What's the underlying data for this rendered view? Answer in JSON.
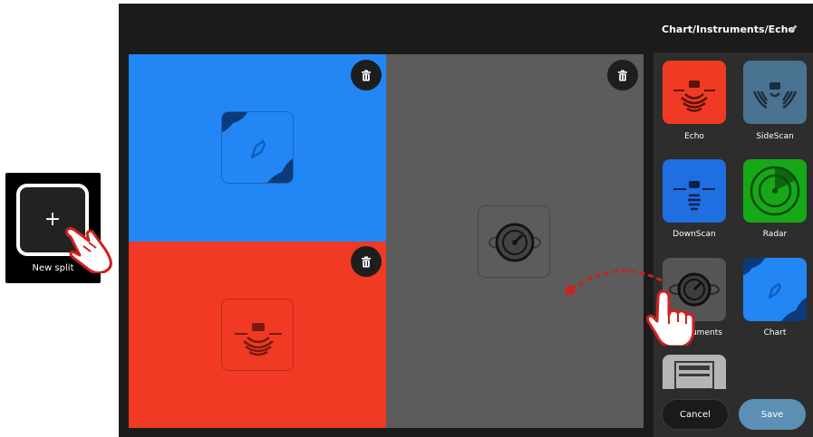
{
  "new_split": {
    "label": "New split",
    "plus": "+"
  },
  "sidebar": {
    "title": "Chart/Instruments/Echo",
    "tiles": [
      {
        "label": "Echo",
        "icon": "echo-icon",
        "color": "#f03a23"
      },
      {
        "label": "SideScan",
        "icon": "sidescan-icon",
        "color": "#4a7291"
      },
      {
        "label": "DownScan",
        "icon": "downscan-icon",
        "color": "#1f6fe0"
      },
      {
        "label": "Radar",
        "icon": "radar-icon",
        "color": "#17a817"
      },
      {
        "label": "struments",
        "icon": "instruments-icon",
        "color": "#555555"
      },
      {
        "label": "Chart",
        "icon": "chart-icon",
        "color": "#2287f5"
      },
      {
        "label": "",
        "icon": "data-table-icon",
        "color": "#b5b5b5"
      }
    ],
    "cancel_label": "Cancel",
    "save_label": "Save"
  },
  "panes": [
    {
      "name": "chart",
      "color": "#2287f5"
    },
    {
      "name": "echo",
      "color": "#f03a23"
    },
    {
      "name": "instruments",
      "color": "#5c5c5c"
    }
  ]
}
